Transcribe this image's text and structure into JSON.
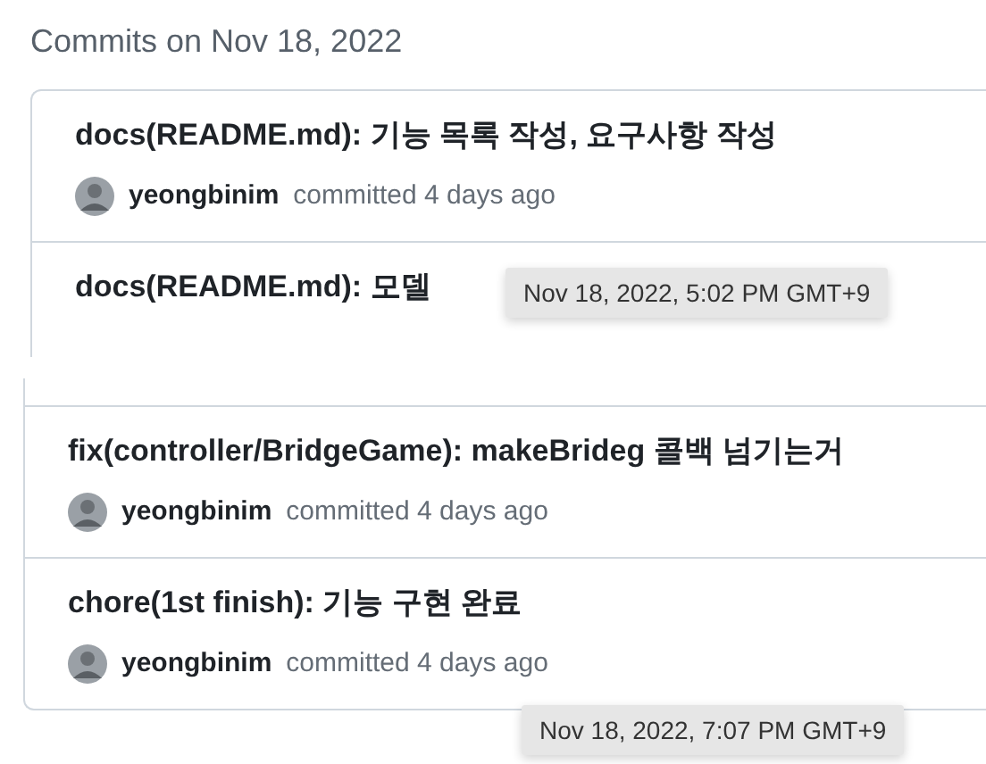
{
  "panels": [
    {
      "heading": "Commits on Nov 18, 2022",
      "commits": [
        {
          "title": "docs(README.md): 기능 목록 작성, 요구사항 작성",
          "author": "yeongbinim",
          "action": "committed",
          "time": "4 days ago"
        },
        {
          "title": "docs(README.md): 모델"
        }
      ],
      "tooltip": "Nov 18, 2022, 5:02 PM GMT+9"
    },
    {
      "commits": [
        {
          "title": "fix(controller/BridgeGame): makeBrideg 콜백 넘기는거",
          "author": "yeongbinim",
          "action": "committed",
          "time": "4 days ago"
        },
        {
          "title": "chore(1st finish): 기능 구현 완료",
          "author": "yeongbinim",
          "action": "committed",
          "time": "4 days ago"
        }
      ],
      "tooltip": "Nov 18, 2022, 7:07 PM GMT+9"
    }
  ]
}
